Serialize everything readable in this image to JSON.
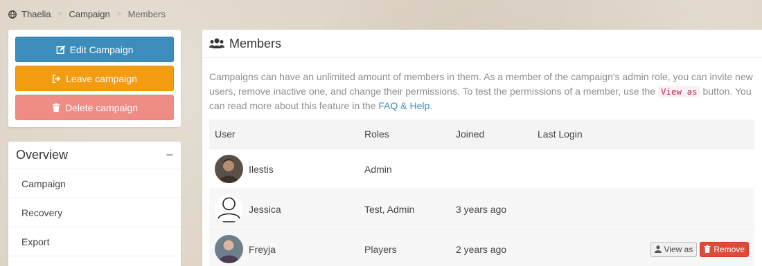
{
  "breadcrumb": {
    "items": [
      "Thaelia",
      "Campaign",
      "Members"
    ],
    "separator": ">"
  },
  "actions": {
    "edit_label": "Edit Campaign",
    "leave_label": "Leave campaign",
    "delete_label": "Delete campaign"
  },
  "overview": {
    "title": "Overview",
    "collapse_symbol": "−",
    "items": [
      "Campaign",
      "Recovery",
      "Export"
    ]
  },
  "members": {
    "title": "Members",
    "description": {
      "part1": "Campaigns can have an unlimited amount of members in them. As a member of the campaign's admin role, you can invite new users, remove inactive one, and change their permissions. To test the permissions of a member, use the ",
      "code": "View as",
      "part2": " button. You can read more about this feature in the ",
      "link": "FAQ & Help",
      "part3": "."
    },
    "columns": [
      "User",
      "Roles",
      "Joined",
      "Last Login"
    ],
    "rows": [
      {
        "name": "Ilestis",
        "roles": "Admin",
        "joined": "",
        "last_login": "",
        "avatar": "portrait-avatar"
      },
      {
        "name": "Jessica",
        "roles": "Test, Admin",
        "joined": "3 years ago",
        "last_login": "",
        "avatar": "user-outline-icon"
      },
      {
        "name": "Freyja",
        "roles": "Players",
        "joined": "2 years ago",
        "last_login": "",
        "avatar": "portrait-avatar"
      }
    ],
    "view_as_label": "View as",
    "remove_label": "Remove"
  },
  "colors": {
    "edit": "#3c8dbc",
    "leave": "#f39c12",
    "delete": "#ee8d85",
    "remove": "#dd4b39",
    "link": "#3c8dbc",
    "code": "#c7254e"
  }
}
